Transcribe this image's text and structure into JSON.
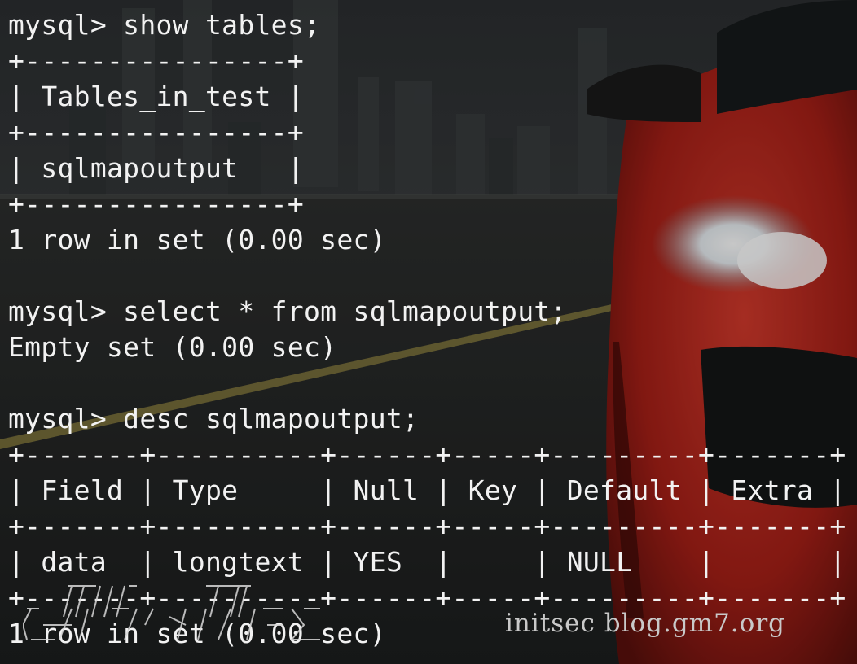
{
  "terminal": {
    "lines": [
      "mysql> show tables;",
      "+----------------+",
      "| Tables_in_test |",
      "+----------------+",
      "| sqlmapoutput   |",
      "+----------------+",
      "1 row in set (0.00 sec)",
      "",
      "mysql> select * from sqlmapoutput;",
      "Empty set (0.00 sec)",
      "",
      "mysql> desc sqlmapoutput;",
      "+-------+----------+------+-----+---------+-------+",
      "| Field | Type     | Null | Key | Default | Extra |",
      "+-------+----------+------+-----+---------+-------+",
      "| data  | longtext | YES  |     | NULL    |       |",
      "+-------+----------+------+-----+---------+-------+",
      "1 row in set (0.00 sec)"
    ]
  },
  "watermark": {
    "text": "initsec blog.gm7.org"
  },
  "colors": {
    "terminal_text": "#f2f2f2",
    "watermark": "#c9c9c9",
    "car_red": "#c0271d"
  }
}
